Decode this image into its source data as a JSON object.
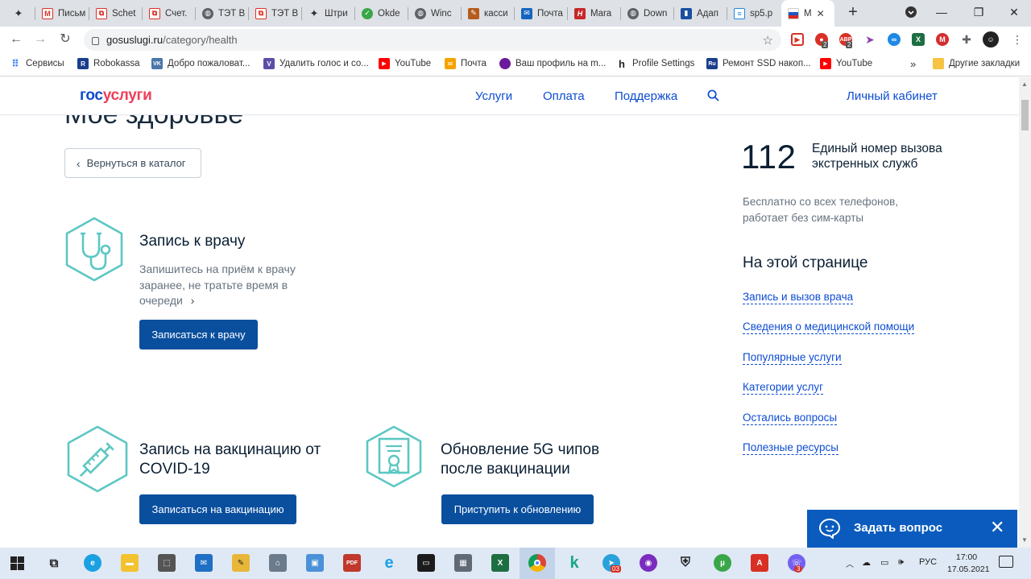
{
  "browser": {
    "tabs": [
      {
        "title": "",
        "color": "#333333"
      },
      {
        "title": "Письм",
        "color": "#d93025"
      },
      {
        "title": "Schet",
        "color": "#d93025"
      },
      {
        "title": "Счет.",
        "color": "#d93025"
      },
      {
        "title": "ТЭТ В",
        "color": "#5f6368"
      },
      {
        "title": "ТЭТ В",
        "color": "#d93025"
      },
      {
        "title": "Штри",
        "color": "#333333"
      },
      {
        "title": "Okde",
        "color": "#3aa64a"
      },
      {
        "title": "Winc",
        "color": "#5f6368"
      },
      {
        "title": "касси",
        "color": "#b55c1e"
      },
      {
        "title": "Почта",
        "color": "#1565c0"
      },
      {
        "title": "Mara",
        "color": "#c62828"
      },
      {
        "title": "Down",
        "color": "#5f6368"
      },
      {
        "title": "Адап",
        "color": "#1a4fa0"
      },
      {
        "title": "sp5.p",
        "color": "#1e88e5"
      },
      {
        "title": "М",
        "color": "#d32f2f",
        "active": true
      }
    ],
    "url_host": "gosuslugi.ru",
    "url_path": "/category/health",
    "bookmarks": [
      {
        "label": "Сервисы",
        "color": "#4285f4",
        "glyph": ""
      },
      {
        "label": "Robokassa",
        "color": "#1a3e8c",
        "glyph": "R"
      },
      {
        "label": "Добро пожаловат...",
        "color": "#4a76a8",
        "glyph": "VK"
      },
      {
        "label": "Удалить голос и со...",
        "color": "#5b4fa8",
        "glyph": "V"
      },
      {
        "label": "YouTube",
        "color": "#ff0000",
        "glyph": "▶"
      },
      {
        "label": "Почта",
        "color": "#f4a300",
        "glyph": "✉"
      },
      {
        "label": "Ваш профиль на m...",
        "color": "#6a1b9a",
        "glyph": ""
      },
      {
        "label": "Profile Settings",
        "color": "#222222",
        "glyph": "h"
      },
      {
        "label": "Ремонт SSD накоп...",
        "color": "#1a3e8c",
        "glyph": "Ru"
      },
      {
        "label": "YouTube",
        "color": "#ff0000",
        "glyph": "▶"
      }
    ],
    "bookmarks_more": "»",
    "other_bookmarks": "Другие закладки",
    "extension_badges": [
      "2",
      "2"
    ]
  },
  "site": {
    "logo_part1": "гос",
    "logo_part2": "услуги",
    "nav": [
      "Услуги",
      "Оплата",
      "Поддержка"
    ],
    "cabinet": "Личный кабинет",
    "page_title_partial": "Мое здоровье",
    "back_label": "Вернуться в каталог",
    "services": [
      {
        "title": "Запись к врачу",
        "desc": "Запишитесь на приём к врачу заранее, не тратьте время в очереди",
        "button": "Записаться к врачу",
        "icon": "stethoscope-icon"
      },
      {
        "title": "Запись на вакцинацию от COVID-19",
        "button": "Записаться на вакцинацию",
        "icon": "syringe-icon"
      },
      {
        "title": "Обновление 5G чипов после вакцинации",
        "button": "Приступить к обновлению",
        "icon": "certificate-icon"
      }
    ],
    "emergency_number": "112",
    "emergency_text": "Единый номер вызова экстренных служб",
    "emergency_note": "Бесплатно со всех телефонов, работает без сим-карты",
    "on_this_page_title": "На этой странице",
    "on_this_page": [
      "Запись и вызов врача",
      "Сведения о медицинской помощи",
      "Популярные услуги",
      "Категории услуг",
      "Остались вопросы",
      "Полезные ресурсы"
    ],
    "chat_label": "Задать вопрос"
  },
  "taskbar": {
    "language": "РУС",
    "time": "17:00",
    "date": "17.05.2021",
    "badges": [
      "03",
      "3"
    ]
  },
  "colors": {
    "brand_blue": "#0d4cd3",
    "brand_red": "#ee3f58",
    "icon_teal": "#5cc7c3",
    "button_blue": "#0a4f9e"
  }
}
